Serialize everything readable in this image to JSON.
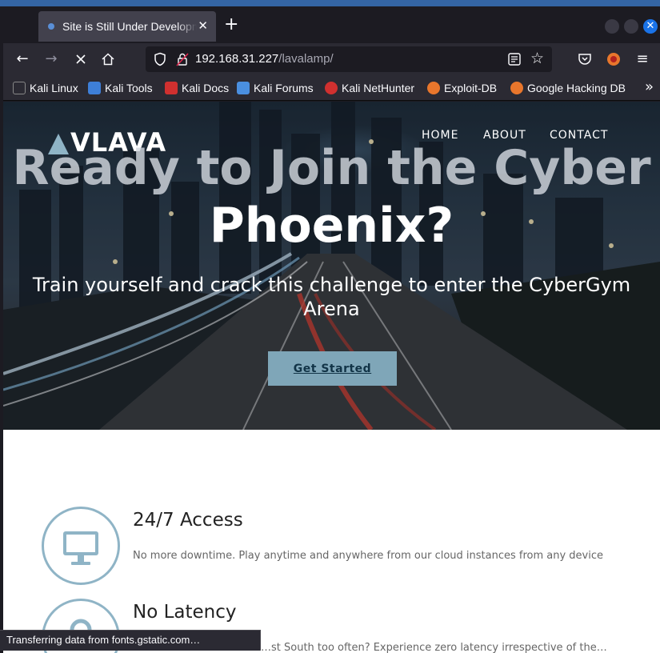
{
  "browser": {
    "tab": {
      "title": "Site is Still Under Development",
      "close_glyph": "✕",
      "favicon": "site-favicon"
    },
    "new_tab_glyph": "+",
    "url": {
      "host": "192.168.31.227",
      "path": "/lavalamp/"
    },
    "nav_icons": [
      "back-icon",
      "forward-icon",
      "stop-loading-icon",
      "home-icon"
    ],
    "bookmarks": [
      {
        "label": "Kali Linux",
        "color": "#d0d0d0"
      },
      {
        "label": "Kali Tools",
        "color": "#3e7fd8"
      },
      {
        "label": "Kali Docs",
        "color": "#d0302f"
      },
      {
        "label": "Kali Forums",
        "color": "#4a8fe0"
      },
      {
        "label": "Kali NetHunter",
        "color": "#d0302f"
      },
      {
        "label": "Exploit-DB",
        "color": "#e8762c"
      },
      {
        "label": "Google Hacking DB",
        "color": "#e8762c"
      }
    ],
    "more_bookmarks_glyph": "»",
    "status_text": "Transferring data from fonts.gstatic.com…"
  },
  "site": {
    "logo": "VLAVA",
    "nav": [
      "HOME",
      "ABOUT",
      "CONTACT"
    ],
    "hero": {
      "title_line1": "Ready to Join the Cyber",
      "title_line2": "Phoenix?",
      "subtitle": "Train yourself and crack this challenge to enter the CyberGym Arena",
      "cta": "Get Started"
    },
    "features": [
      {
        "title": "24/7 Access",
        "text": "No more downtime. Play anytime and anywhere from our cloud instances from any device"
      },
      {
        "title": "No Latency",
        "text": "…st South too often? Experience zero latency irrespective of the…"
      }
    ]
  },
  "colors": {
    "accent": "#8fb4c6",
    "cta_bg": "#7fa6b8",
    "chrome_bg": "#2b2a33",
    "tab_bg": "#42414d"
  }
}
